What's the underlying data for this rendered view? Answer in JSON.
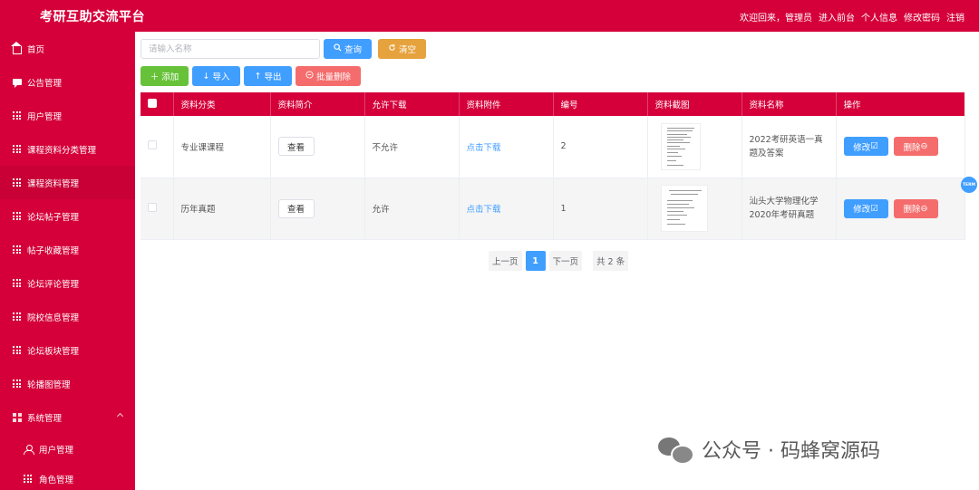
{
  "header": {
    "title": "考研互助交流平台",
    "welcome": "欢迎回来，管理员",
    "links": [
      "进入前台",
      "个人信息",
      "修改密码",
      "注销"
    ]
  },
  "sidebar": {
    "items": [
      {
        "label": "首页",
        "icon": "home-icon"
      },
      {
        "label": "公告管理",
        "icon": "chat-icon"
      },
      {
        "label": "用户管理",
        "icon": "grid-icon"
      },
      {
        "label": "课程资料分类管理",
        "icon": "grid-icon"
      },
      {
        "label": "课程资料管理",
        "icon": "grid-icon"
      },
      {
        "label": "论坛帖子管理",
        "icon": "grid-icon"
      },
      {
        "label": "帖子收藏管理",
        "icon": "grid-icon"
      },
      {
        "label": "论坛评论管理",
        "icon": "grid-icon"
      },
      {
        "label": "院校信息管理",
        "icon": "grid-icon"
      },
      {
        "label": "论坛板块管理",
        "icon": "grid-icon"
      },
      {
        "label": "轮播图管理",
        "icon": "grid-icon"
      },
      {
        "label": "系统管理",
        "icon": "windows-icon"
      }
    ],
    "sub_items": [
      {
        "label": "用户管理",
        "icon": "user-icon"
      },
      {
        "label": "角色管理",
        "icon": "grid-icon"
      }
    ]
  },
  "search": {
    "placeholder": "请输入名称",
    "query_label": "查询",
    "clear_label": "清空"
  },
  "actions": {
    "add_label": "添加",
    "import_label": "导入",
    "export_label": "导出",
    "batch_delete_label": "批量删除"
  },
  "table": {
    "headers": [
      "资料分类",
      "资料简介",
      "允许下载",
      "资料附件",
      "编号",
      "资料截图",
      "资料名称",
      "操作"
    ],
    "rows": [
      {
        "category": "专业课课程",
        "intro_btn": "查看",
        "download": "不允许",
        "attachment": "点击下载",
        "id": "2",
        "name": "2022考研英语一真题及答案",
        "edit": "修改",
        "delete": "删除"
      },
      {
        "category": "历年真题",
        "intro_btn": "查看",
        "download": "允许",
        "attachment": "点击下载",
        "id": "1",
        "name": "汕头大学物理化学2020年考研真题",
        "edit": "修改",
        "delete": "删除"
      }
    ]
  },
  "pagination": {
    "prev": "上一页",
    "current": "1",
    "next": "下一页",
    "total": "共 2 条"
  },
  "float_badge": "TERM",
  "watermark": "公众号 · 码蜂窝源码",
  "colors": {
    "primary": "#d5003a",
    "blue": "#409eff",
    "orange": "#e6a23c",
    "green": "#67c23a",
    "red": "#f56c6c"
  }
}
